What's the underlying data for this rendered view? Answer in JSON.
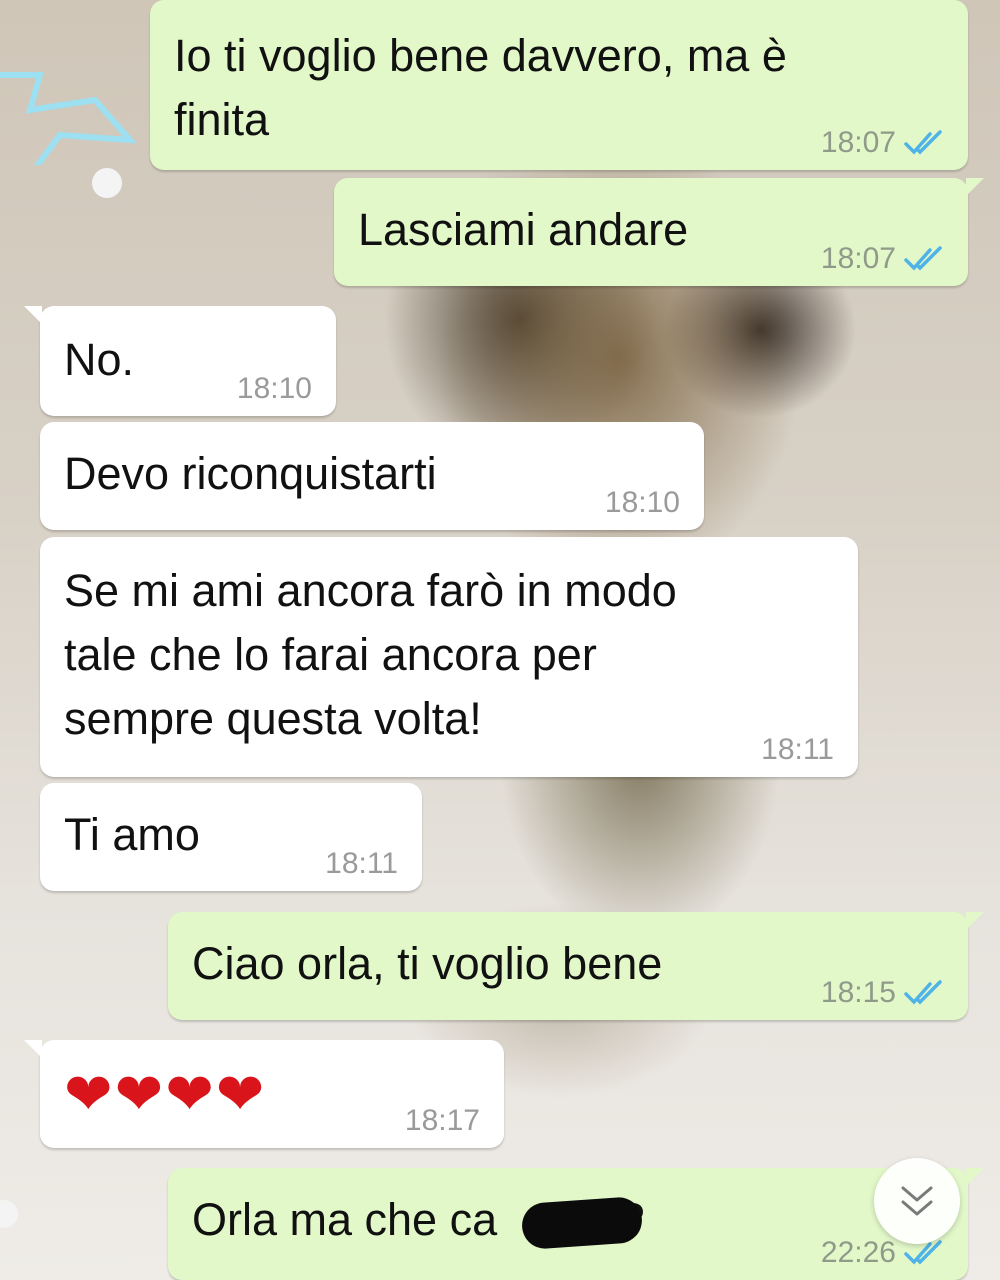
{
  "messages": [
    {
      "id": "m1",
      "side": "out",
      "text": "Io ti voglio bene davvero, ma è\nfinita",
      "time": "18:07",
      "status": "read"
    },
    {
      "id": "m2",
      "side": "out",
      "text": "Lasciami andare",
      "time": "18:07",
      "status": "read"
    },
    {
      "id": "m3",
      "side": "in",
      "text": "No.",
      "time": "18:10"
    },
    {
      "id": "m4",
      "side": "in",
      "text": "Devo riconquistarti",
      "time": "18:10"
    },
    {
      "id": "m5",
      "side": "in",
      "text": "Se mi ami ancora farò in modo\ntale che lo farai ancora per\nsempre questa volta!",
      "time": "18:11"
    },
    {
      "id": "m6",
      "side": "in",
      "text": "Ti amo",
      "time": "18:11"
    },
    {
      "id": "m7",
      "side": "out",
      "text": "Ciao orla, ti voglio bene",
      "time": "18:15",
      "status": "read"
    },
    {
      "id": "m8",
      "side": "in",
      "text": "❤❤❤❤",
      "time": "18:17"
    },
    {
      "id": "m9",
      "side": "out",
      "text": "Orla ma che ca   o fai?",
      "time": "22:26",
      "status": "read"
    }
  ],
  "colors": {
    "outgoing": "#e2f8c9",
    "incoming": "#ffffff",
    "tick_read": "#4fb3e8"
  },
  "icons": {
    "read_receipt": "double-check-icon",
    "scroll_down": "chevron-double-down-icon"
  }
}
